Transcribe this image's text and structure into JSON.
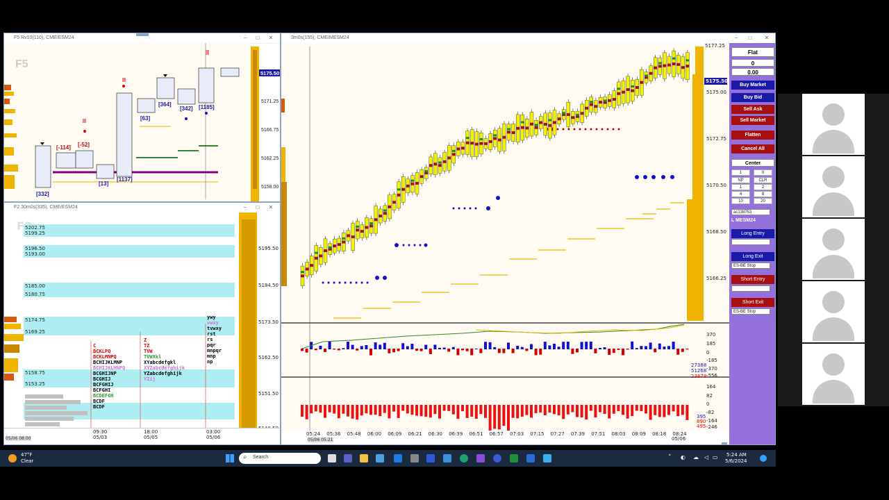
{
  "windows": {
    "tl_title": "F5 Rv10(110), CME/ESM24",
    "bl_title": "F2 30m0s(335), CME/ESM24",
    "main_title": "3m0s(155), CME/MESM24"
  },
  "tl_chart": {
    "watermark": "F5",
    "prices": [
      "5171.25",
      "5166.75",
      "5162.25",
      "5158.00"
    ],
    "last_price": "5175.50",
    "labels": [
      "[332]",
      "[-114]",
      "[-52]",
      "[13]",
      "[1137]",
      "[63]",
      "[364]",
      "[342]",
      "[1185]"
    ]
  },
  "bl_chart": {
    "watermark": "F2",
    "levels": [
      "5202.75",
      "5199.25",
      "5196.50",
      "5193.00",
      "5185.00",
      "5180.75",
      "5174.75",
      "5169.25",
      "5158.75",
      "5153.25"
    ],
    "prices": [
      "5195.50",
      "5184.50",
      "5173.50",
      "5162.50",
      "5151.50",
      "5140.50"
    ],
    "time_labels": [
      {
        "t": "09:30",
        "d": "05/03"
      },
      {
        "t": "18:00",
        "d": "05/05"
      },
      {
        "t": "03:00",
        "d": "05/06"
      }
    ],
    "left_date": "05/06 08:00",
    "tpo_rows": [
      "ywy",
      "vwxy",
      "tvwxy",
      "rst",
      "rs",
      "pqr",
      "mnpqr",
      "mnp",
      "np"
    ],
    "tpo_left": [
      "C",
      "BCKLPQ",
      "BCKLMNPQ",
      "BCHIJKLMNP",
      "BCHIJKLMNPQ",
      "BCGHIJNP",
      "BCGHIJ",
      "BCFGHIJ",
      "BCFGHI",
      "BCDEFGH",
      "BCDF",
      "BCDF"
    ],
    "tpo_mid": [
      "Z",
      "TZ",
      "TVW",
      "TVWXkl",
      "XYabcdefgkl",
      "XYZabcdefghijk",
      "YZabcdefghijk",
      "YZij"
    ]
  },
  "main_chart": {
    "prices": [
      "5177.25",
      "5175.00",
      "5172.75",
      "5170.50",
      "5168.50",
      "5166.25"
    ],
    "last_price": "5175.50",
    "ind1_labels": [
      "370",
      "185",
      "0",
      "-185",
      "-370",
      "-556"
    ],
    "ind1_values": [
      "27388",
      "51268",
      "23878"
    ],
    "ind2_labels": [
      "164",
      "82",
      "0",
      "-82",
      "-164",
      "-246"
    ],
    "ind2_values": [
      "395",
      "890",
      "495"
    ],
    "time_labels": [
      "05:24",
      "05:36",
      "05:48",
      "06:00",
      "06:09",
      "06:21",
      "06:30",
      "06:39",
      "06:51",
      "06:57",
      "07:03",
      "07:15",
      "07:27",
      "07:39",
      "07:51",
      "08:03",
      "08:09",
      "08:18",
      "08:24"
    ],
    "date_left": "05/06 05:21",
    "date_right": "05/06"
  },
  "side_panel": {
    "position": "Flat",
    "qty": "0",
    "pnl": "0.00",
    "buttons": [
      "Buy Market",
      "Buy Bid",
      "Sell Ask",
      "Sell Market",
      "Flatten",
      "Cancel All"
    ],
    "center": "Center",
    "qty_input": "1",
    "qty_right": "0",
    "grid": [
      "NP",
      "CLR",
      "1",
      "2",
      "4",
      "8",
      "10",
      "20"
    ],
    "account": "ac138753",
    "symbol": "L MESM24",
    "long_entry": "Long Entry",
    "long_exit": "Long Exit",
    "long_exit_sel": "ES-BE Stop",
    "short_entry": "Short Entry",
    "short_exit": "Short Exit",
    "short_exit_sel": "ES-BE Stop"
  },
  "taskbar": {
    "weather_temp": "47°F",
    "weather_desc": "Clear",
    "search": "Search",
    "time": "5:24 AM",
    "date": "5/6/2024"
  },
  "colors": {
    "up_bar": "#f2f200",
    "poc": "#a81010",
    "volume": "#f0b400",
    "bid_dots": "#1010d0",
    "panel_purple": "#9370db"
  }
}
